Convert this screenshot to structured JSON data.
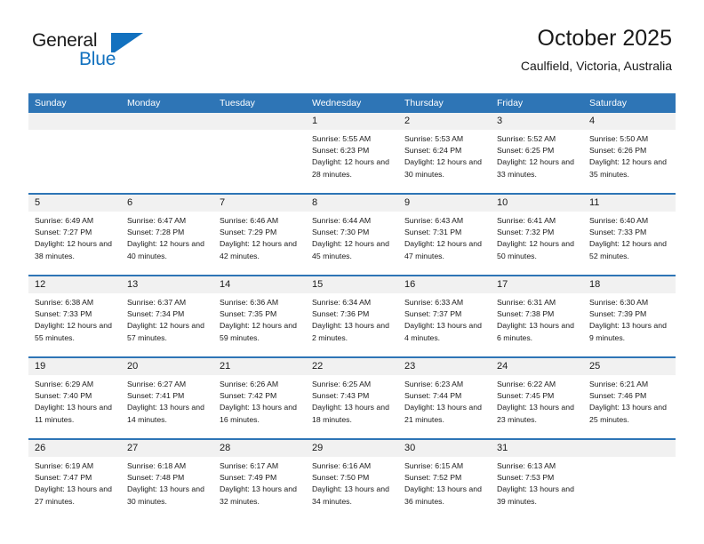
{
  "brand": {
    "name_part1": "General",
    "name_part2": "Blue",
    "logo_icon": "triangle-flag-icon",
    "color_primary": "#1271bf"
  },
  "header": {
    "title": "October 2025",
    "subtitle": "Caulfield, Victoria, Australia"
  },
  "theme": {
    "header_bg": "#2e75b6",
    "daynum_bg": "#f1f1f1",
    "text": "#1a1a1a",
    "page_bg": "#ffffff"
  },
  "weekday_headers": [
    "Sunday",
    "Monday",
    "Tuesday",
    "Wednesday",
    "Thursday",
    "Friday",
    "Saturday"
  ],
  "weeks": [
    [
      {
        "day": "",
        "sunrise": "",
        "sunset": "",
        "daylight": "",
        "blank": true
      },
      {
        "day": "",
        "sunrise": "",
        "sunset": "",
        "daylight": "",
        "blank": true
      },
      {
        "day": "",
        "sunrise": "",
        "sunset": "",
        "daylight": "",
        "blank": true
      },
      {
        "day": "1",
        "sunrise": "Sunrise: 5:55 AM",
        "sunset": "Sunset: 6:23 PM",
        "daylight": "Daylight: 12 hours and 28 minutes."
      },
      {
        "day": "2",
        "sunrise": "Sunrise: 5:53 AM",
        "sunset": "Sunset: 6:24 PM",
        "daylight": "Daylight: 12 hours and 30 minutes."
      },
      {
        "day": "3",
        "sunrise": "Sunrise: 5:52 AM",
        "sunset": "Sunset: 6:25 PM",
        "daylight": "Daylight: 12 hours and 33 minutes."
      },
      {
        "day": "4",
        "sunrise": "Sunrise: 5:50 AM",
        "sunset": "Sunset: 6:26 PM",
        "daylight": "Daylight: 12 hours and 35 minutes."
      }
    ],
    [
      {
        "day": "5",
        "sunrise": "Sunrise: 6:49 AM",
        "sunset": "Sunset: 7:27 PM",
        "daylight": "Daylight: 12 hours and 38 minutes."
      },
      {
        "day": "6",
        "sunrise": "Sunrise: 6:47 AM",
        "sunset": "Sunset: 7:28 PM",
        "daylight": "Daylight: 12 hours and 40 minutes."
      },
      {
        "day": "7",
        "sunrise": "Sunrise: 6:46 AM",
        "sunset": "Sunset: 7:29 PM",
        "daylight": "Daylight: 12 hours and 42 minutes."
      },
      {
        "day": "8",
        "sunrise": "Sunrise: 6:44 AM",
        "sunset": "Sunset: 7:30 PM",
        "daylight": "Daylight: 12 hours and 45 minutes."
      },
      {
        "day": "9",
        "sunrise": "Sunrise: 6:43 AM",
        "sunset": "Sunset: 7:31 PM",
        "daylight": "Daylight: 12 hours and 47 minutes."
      },
      {
        "day": "10",
        "sunrise": "Sunrise: 6:41 AM",
        "sunset": "Sunset: 7:32 PM",
        "daylight": "Daylight: 12 hours and 50 minutes."
      },
      {
        "day": "11",
        "sunrise": "Sunrise: 6:40 AM",
        "sunset": "Sunset: 7:33 PM",
        "daylight": "Daylight: 12 hours and 52 minutes."
      }
    ],
    [
      {
        "day": "12",
        "sunrise": "Sunrise: 6:38 AM",
        "sunset": "Sunset: 7:33 PM",
        "daylight": "Daylight: 12 hours and 55 minutes."
      },
      {
        "day": "13",
        "sunrise": "Sunrise: 6:37 AM",
        "sunset": "Sunset: 7:34 PM",
        "daylight": "Daylight: 12 hours and 57 minutes."
      },
      {
        "day": "14",
        "sunrise": "Sunrise: 6:36 AM",
        "sunset": "Sunset: 7:35 PM",
        "daylight": "Daylight: 12 hours and 59 minutes."
      },
      {
        "day": "15",
        "sunrise": "Sunrise: 6:34 AM",
        "sunset": "Sunset: 7:36 PM",
        "daylight": "Daylight: 13 hours and 2 minutes."
      },
      {
        "day": "16",
        "sunrise": "Sunrise: 6:33 AM",
        "sunset": "Sunset: 7:37 PM",
        "daylight": "Daylight: 13 hours and 4 minutes."
      },
      {
        "day": "17",
        "sunrise": "Sunrise: 6:31 AM",
        "sunset": "Sunset: 7:38 PM",
        "daylight": "Daylight: 13 hours and 6 minutes."
      },
      {
        "day": "18",
        "sunrise": "Sunrise: 6:30 AM",
        "sunset": "Sunset: 7:39 PM",
        "daylight": "Daylight: 13 hours and 9 minutes."
      }
    ],
    [
      {
        "day": "19",
        "sunrise": "Sunrise: 6:29 AM",
        "sunset": "Sunset: 7:40 PM",
        "daylight": "Daylight: 13 hours and 11 minutes."
      },
      {
        "day": "20",
        "sunrise": "Sunrise: 6:27 AM",
        "sunset": "Sunset: 7:41 PM",
        "daylight": "Daylight: 13 hours and 14 minutes."
      },
      {
        "day": "21",
        "sunrise": "Sunrise: 6:26 AM",
        "sunset": "Sunset: 7:42 PM",
        "daylight": "Daylight: 13 hours and 16 minutes."
      },
      {
        "day": "22",
        "sunrise": "Sunrise: 6:25 AM",
        "sunset": "Sunset: 7:43 PM",
        "daylight": "Daylight: 13 hours and 18 minutes."
      },
      {
        "day": "23",
        "sunrise": "Sunrise: 6:23 AM",
        "sunset": "Sunset: 7:44 PM",
        "daylight": "Daylight: 13 hours and 21 minutes."
      },
      {
        "day": "24",
        "sunrise": "Sunrise: 6:22 AM",
        "sunset": "Sunset: 7:45 PM",
        "daylight": "Daylight: 13 hours and 23 minutes."
      },
      {
        "day": "25",
        "sunrise": "Sunrise: 6:21 AM",
        "sunset": "Sunset: 7:46 PM",
        "daylight": "Daylight: 13 hours and 25 minutes."
      }
    ],
    [
      {
        "day": "26",
        "sunrise": "Sunrise: 6:19 AM",
        "sunset": "Sunset: 7:47 PM",
        "daylight": "Daylight: 13 hours and 27 minutes."
      },
      {
        "day": "27",
        "sunrise": "Sunrise: 6:18 AM",
        "sunset": "Sunset: 7:48 PM",
        "daylight": "Daylight: 13 hours and 30 minutes."
      },
      {
        "day": "28",
        "sunrise": "Sunrise: 6:17 AM",
        "sunset": "Sunset: 7:49 PM",
        "daylight": "Daylight: 13 hours and 32 minutes."
      },
      {
        "day": "29",
        "sunrise": "Sunrise: 6:16 AM",
        "sunset": "Sunset: 7:50 PM",
        "daylight": "Daylight: 13 hours and 34 minutes."
      },
      {
        "day": "30",
        "sunrise": "Sunrise: 6:15 AM",
        "sunset": "Sunset: 7:52 PM",
        "daylight": "Daylight: 13 hours and 36 minutes."
      },
      {
        "day": "31",
        "sunrise": "Sunrise: 6:13 AM",
        "sunset": "Sunset: 7:53 PM",
        "daylight": "Daylight: 13 hours and 39 minutes."
      },
      {
        "day": "",
        "sunrise": "",
        "sunset": "",
        "daylight": "",
        "blank": true
      }
    ]
  ]
}
